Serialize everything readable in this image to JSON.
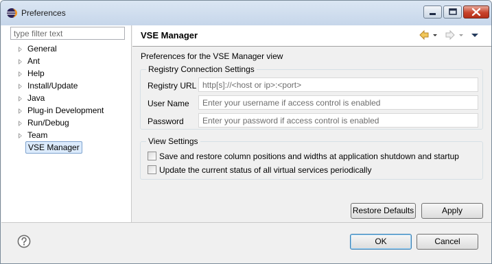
{
  "window": {
    "title": "Preferences"
  },
  "filter": {
    "placeholder": "type filter text"
  },
  "tree": {
    "items": [
      {
        "label": "General",
        "expandable": true
      },
      {
        "label": "Ant",
        "expandable": true
      },
      {
        "label": "Help",
        "expandable": true
      },
      {
        "label": "Install/Update",
        "expandable": true
      },
      {
        "label": "Java",
        "expandable": true
      },
      {
        "label": "Plug-in Development",
        "expandable": true
      },
      {
        "label": "Run/Debug",
        "expandable": true
      },
      {
        "label": "Team",
        "expandable": true
      },
      {
        "label": "VSE Manager",
        "expandable": false,
        "selected": true
      }
    ]
  },
  "page": {
    "title": "VSE Manager",
    "description": "Preferences for the VSE Manager view"
  },
  "registry": {
    "group_title": "Registry Connection Settings",
    "url_label": "Registry URL",
    "url_placeholder": "http[s]://<host or ip>:<port>",
    "username_label": "User Name",
    "username_placeholder": "Enter your username if access control is enabled",
    "password_label": "Password",
    "password_placeholder": "Enter your password if access control is enabled"
  },
  "view_settings": {
    "group_title": "View Settings",
    "save_columns": {
      "label": "Save and restore column positions and widths at application shutdown and startup",
      "checked": false
    },
    "update_status": {
      "label": "Update the current status of all virtual services periodically",
      "checked": false
    }
  },
  "buttons": {
    "restore_defaults": "Restore Defaults",
    "apply": "Apply",
    "ok": "OK",
    "cancel": "Cancel"
  },
  "icons": {
    "app": "eclipse-icon",
    "back": "back-arrow-icon",
    "forward": "forward-arrow-icon",
    "menu": "view-menu-icon",
    "help": "help-icon"
  },
  "colors": {
    "selection_fill": "#dcebfc",
    "selection_border": "#7da2ce",
    "close_button": "#c8432b",
    "back_arrow": "#e8b54a"
  }
}
